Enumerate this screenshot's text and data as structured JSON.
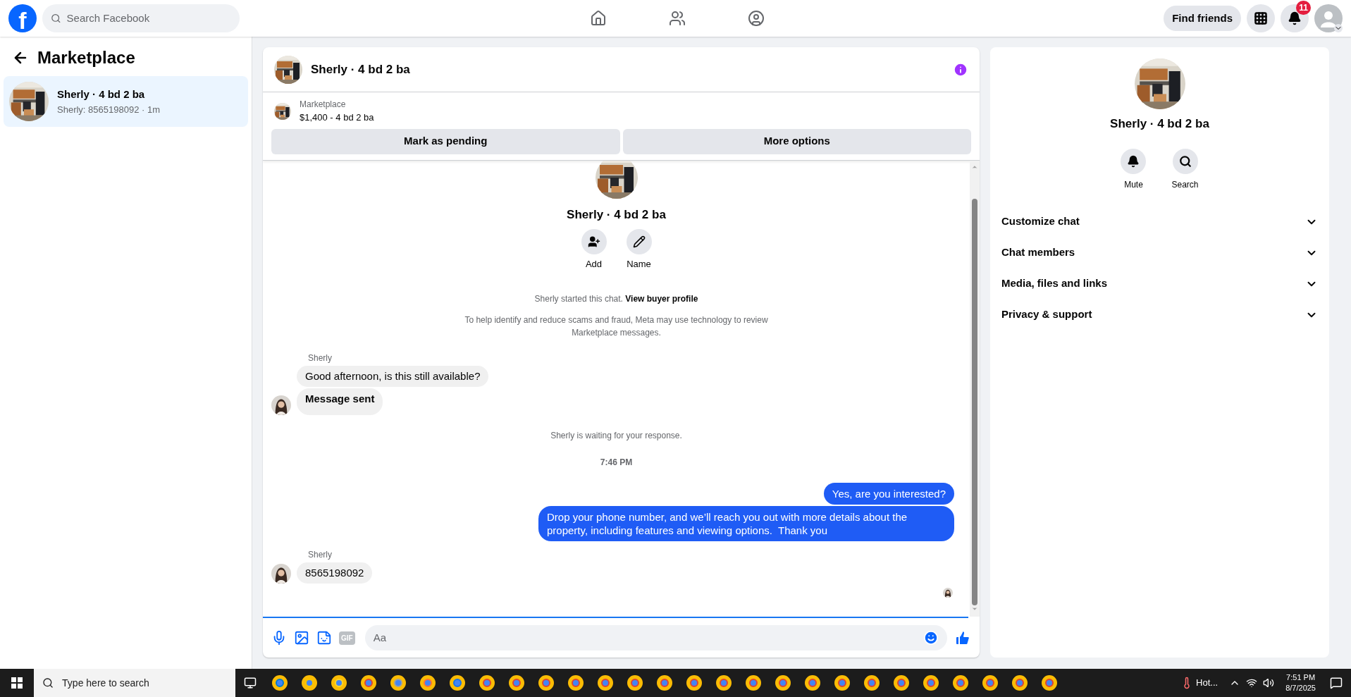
{
  "topbar": {
    "logo": "f",
    "search_placeholder": "Search Facebook",
    "find_friends": "Find friends",
    "notification_count": "11"
  },
  "sidebar": {
    "title": "Marketplace",
    "conversations": [
      {
        "title": "Sherly · 4 bd 2 ba",
        "preview": "Sherly: 8565198092 · 1m",
        "selected": true
      }
    ]
  },
  "chat": {
    "title": "Sherly · 4 bd 2 ba",
    "listing": {
      "label": "Marketplace",
      "summary": "$1,400 - 4 bd 2 ba"
    },
    "actions": [
      "Mark as pending",
      "More options"
    ],
    "intro": {
      "title": "Sherly · 4 bd 2 ba",
      "buttons": [
        {
          "kind": "add",
          "label": "Add"
        },
        {
          "kind": "name",
          "label": "Name"
        }
      ],
      "started": "Sherly started this chat.",
      "profile_link": "View buyer profile",
      "notice": "To help identify and reduce scams and fraud, Meta may use technology to review Marketplace messages."
    },
    "messages": [
      {
        "kind": "sender",
        "text": "Sherly"
      },
      {
        "kind": "incoming",
        "text": "Good afternoon, is this still available?",
        "bold": false,
        "avatar": false
      },
      {
        "kind": "incoming",
        "text": "Message sent",
        "bold": true,
        "avatar": true
      },
      {
        "kind": "system",
        "text": "Sherly is waiting for your response."
      },
      {
        "kind": "time",
        "text": "7:46 PM"
      },
      {
        "kind": "outgoing",
        "text": "Yes, are you interested?"
      },
      {
        "kind": "outgoing",
        "text": "Drop your phone number, and we’ll reach you out with more details about the property, including features and viewing options.  Thank you"
      },
      {
        "kind": "sender",
        "text": "Sherly"
      },
      {
        "kind": "incoming",
        "text": "8565198092",
        "bold": false,
        "avatar": true
      }
    ],
    "composer": {
      "gif_label": "GIF",
      "placeholder": "Aa"
    }
  },
  "details": {
    "title": "Sherly · 4 bd 2 ba",
    "buttons": [
      {
        "kind": "mute",
        "label": "Mute"
      },
      {
        "kind": "search",
        "label": "Search"
      }
    ],
    "sections": [
      {
        "label": "Customize chat",
        "expanded": false
      },
      {
        "label": "Chat members",
        "expanded": false
      },
      {
        "label": "Media, files and links",
        "expanded": false
      },
      {
        "label": "Privacy & support",
        "expanded": false
      }
    ]
  },
  "taskbar": {
    "search_placeholder": "Type here to search",
    "weather": "Hot...",
    "time": "7:51 PM",
    "date": "8/7/2025"
  }
}
